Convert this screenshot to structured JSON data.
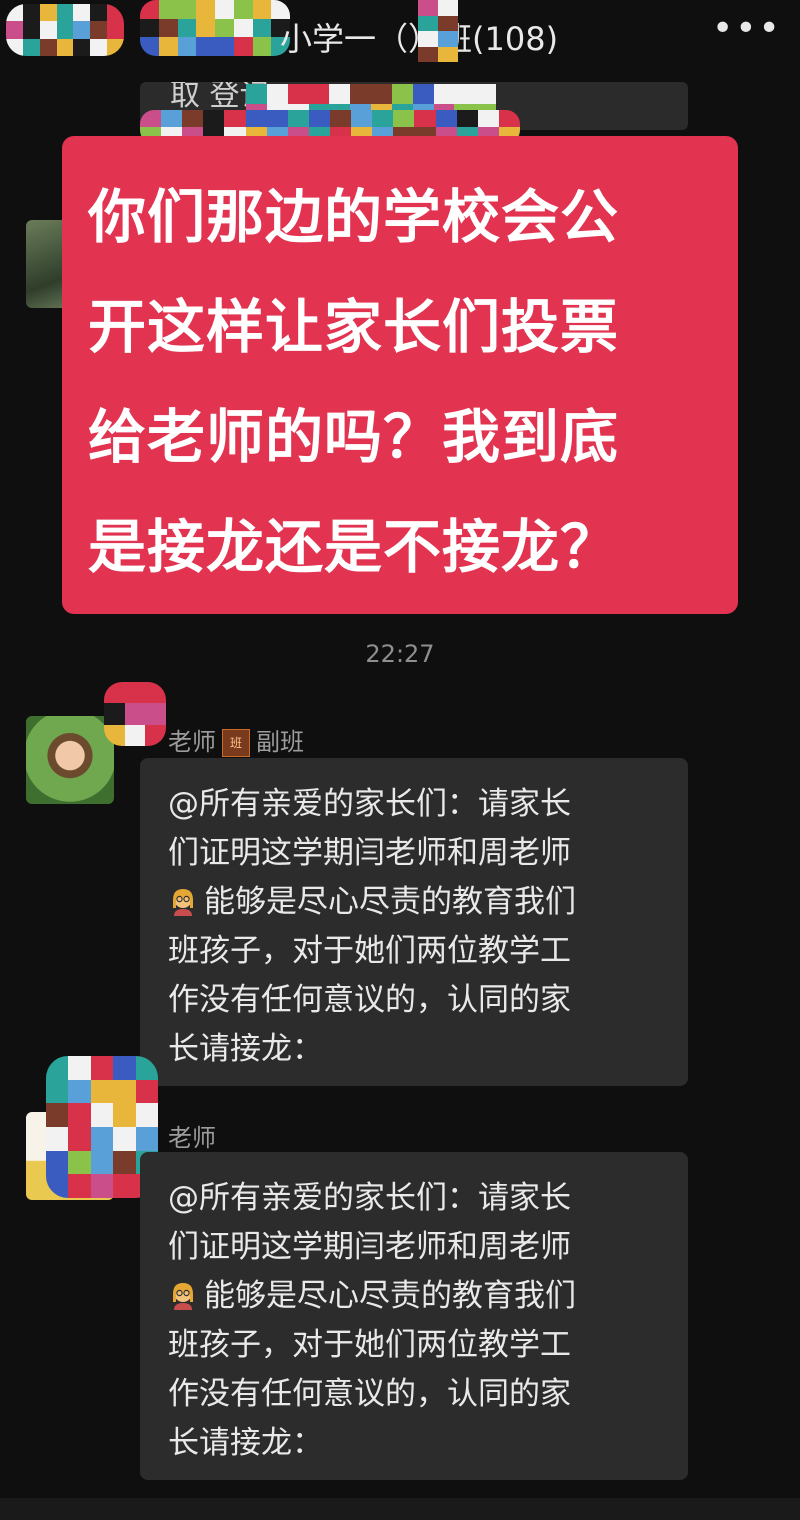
{
  "header": {
    "title": "小学一（）班(108)",
    "more": "•••"
  },
  "previous_message": {
    "text": "取  登记。"
  },
  "overlay_caption": {
    "lines": [
      "你们那边的学校会公",
      "开这样让家长们投票",
      "给老师的吗？我到底",
      "是接龙还是不接龙？"
    ],
    "color": "#e23350"
  },
  "timestamp": "22:27",
  "messages": [
    {
      "sender": "老师",
      "badge": "班",
      "role": "副班",
      "lines": [
        "@所有亲爱的家长们：请家长",
        "们证明这学期闫老师和周老师",
        "能够是尽心尽责的教育我们",
        "班孩子，对于她们两位教学工",
        "作没有任何意议的，认同的家",
        "长请接龙："
      ]
    },
    {
      "sender": "老师",
      "lines": [
        "@所有亲爱的家长们：请家长",
        "们证明这学期闫老师和周老师",
        "能够是尽心尽责的教育我们",
        "班孩子，对于她们两位教学工",
        "作没有任何意议的，认同的家",
        "长请接龙："
      ]
    }
  ]
}
